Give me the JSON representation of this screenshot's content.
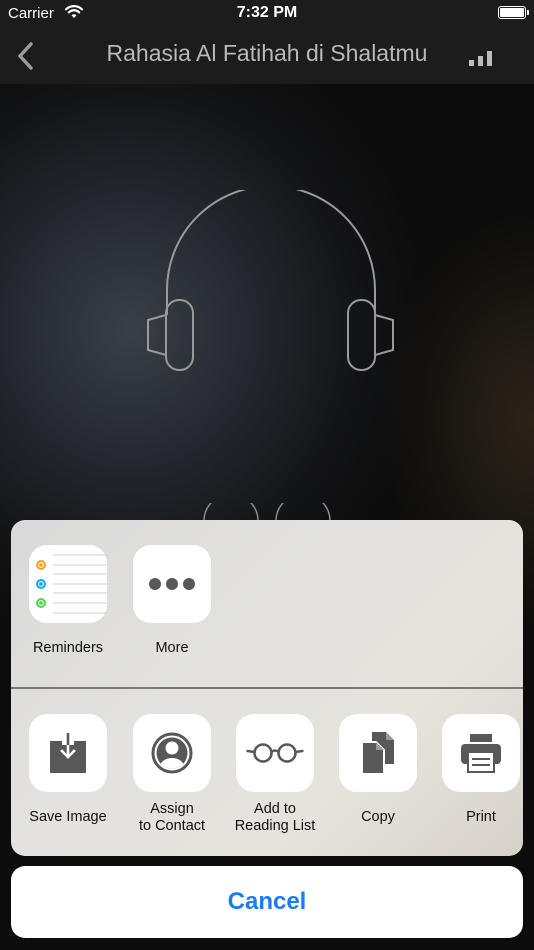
{
  "status_bar": {
    "carrier": "Carrier",
    "time": "7:32 PM"
  },
  "nav": {
    "title": "Rahasia Al Fatihah di Shalatmu"
  },
  "share_sheet": {
    "apps": [
      {
        "label": "Reminders",
        "icon": "reminders-icon"
      },
      {
        "label": "More",
        "icon": "more-icon"
      }
    ],
    "actions": [
      {
        "label": "Save Image",
        "icon": "save-image-icon"
      },
      {
        "label_line1": "Assign",
        "label_line2": "to Contact",
        "icon": "contact-icon"
      },
      {
        "label_line1": "Add to",
        "label_line2": "Reading List",
        "icon": "glasses-icon"
      },
      {
        "label": "Copy",
        "icon": "copy-icon"
      },
      {
        "label": "Print",
        "icon": "print-icon"
      }
    ],
    "cancel_label": "Cancel"
  },
  "colors": {
    "accent": "#1a7cf5",
    "reminder_orange": "#f7a125",
    "reminder_blue": "#1ea5ef",
    "reminder_green": "#5bd150"
  }
}
